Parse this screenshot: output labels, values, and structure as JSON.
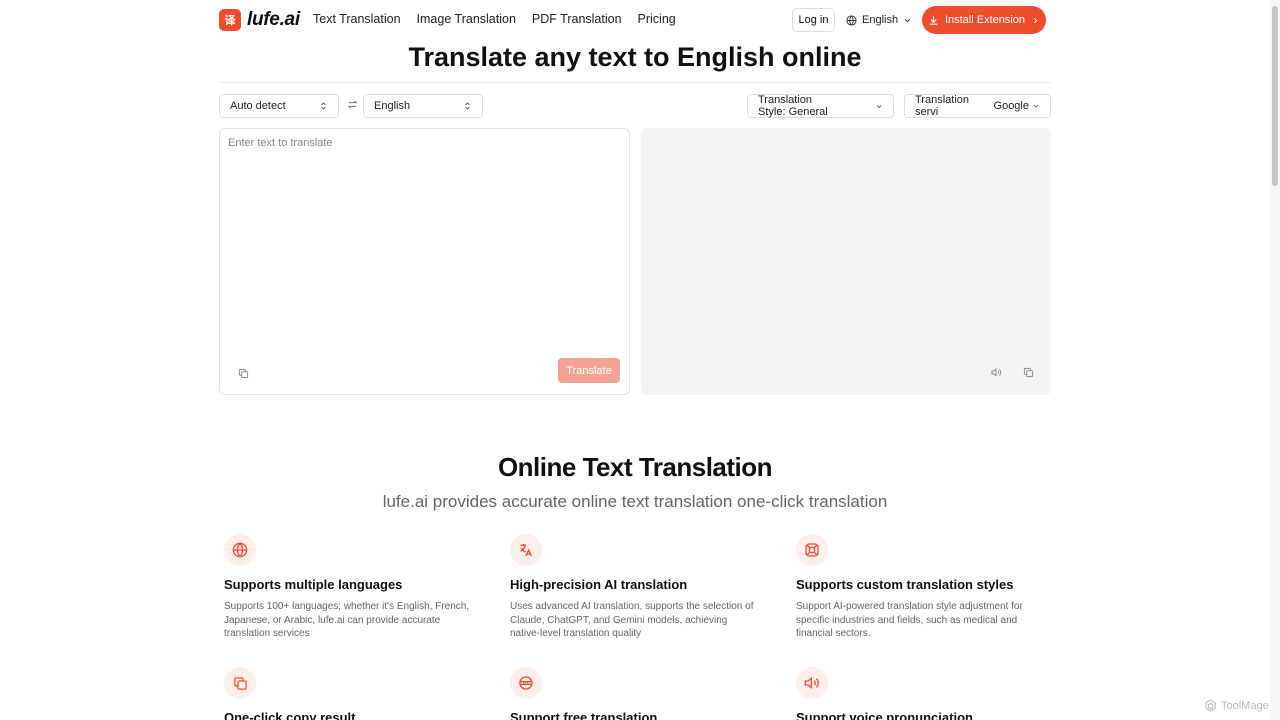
{
  "nav": {
    "logo_mark": "译",
    "logo_text": "lufe.ai",
    "links": [
      "Text Translation",
      "Image Translation",
      "PDF Translation",
      "Pricing"
    ],
    "login_label": "Log in",
    "language_label": "English",
    "install_label": "Install Extension"
  },
  "hero": {
    "title": "Translate any text to English online"
  },
  "selectors": {
    "source_language": "Auto detect",
    "target_language": "English",
    "style_label": "Translation Style:",
    "style_value": "General",
    "service_label": "Translation servi",
    "service_value": "Google"
  },
  "input_panel": {
    "placeholder": "Enter text to translate",
    "value": "",
    "translate_label": "Translate"
  },
  "section": {
    "title": "Online Text Translation",
    "subtitle": "lufe.ai provides accurate online text translation one-click translation"
  },
  "features": [
    {
      "icon": "globe-icon",
      "title": "Supports multiple languages",
      "desc": "Supports 100+ languages; whether it's English, French, Japanese, or Arabic, lufe.ai can provide accurate translation services"
    },
    {
      "icon": "translate-icon",
      "title": "High-precision AI translation",
      "desc": "Uses advanced AI translation, supports the selection of Claude, ChatGPT, and Gemini models, achieving native-level translation quality"
    },
    {
      "icon": "style-icon",
      "title": "Supports custom translation styles",
      "desc": "Support AI-powered translation style adjustment for specific industries and fields, such as medical and financial sectors."
    },
    {
      "icon": "copy-icon",
      "title": "One-click copy result",
      "desc": ""
    },
    {
      "icon": "free-icon",
      "title": "Support free translation",
      "desc": ""
    },
    {
      "icon": "speaker-icon",
      "title": "Support voice pronunciation",
      "desc": ""
    }
  ],
  "watermark": "ToolMage",
  "colors": {
    "accent": "#ee4d2d",
    "accent_light": "#f4a392",
    "panel_bg": "#f3f3f3"
  }
}
